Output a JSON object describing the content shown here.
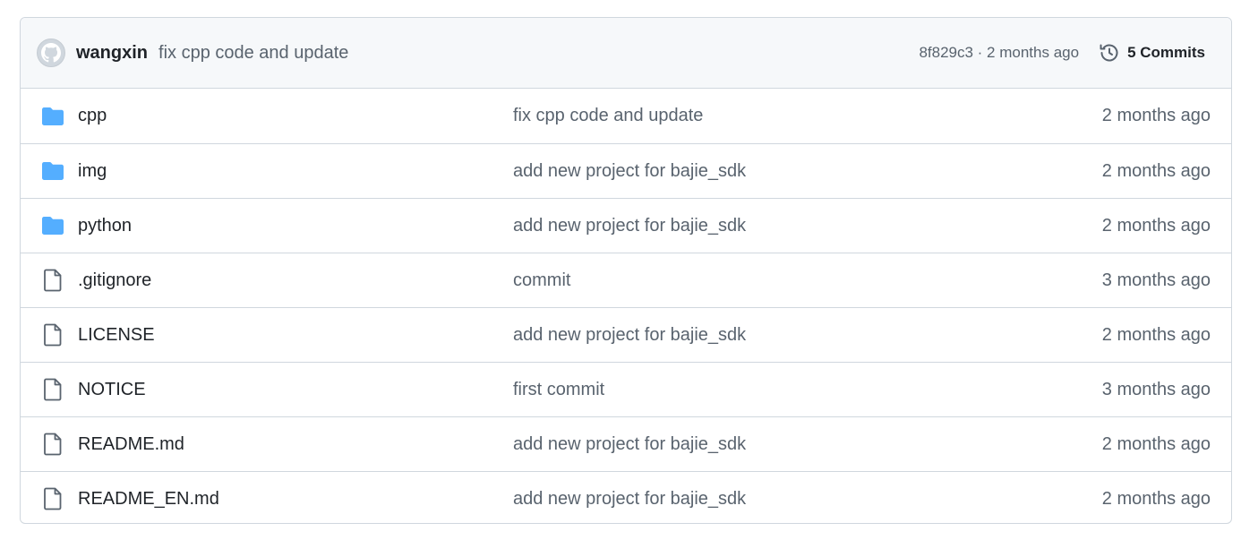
{
  "latest_commit": {
    "author": "wangxin",
    "message": "fix cpp code and update",
    "meta": "8f829c3 · 2 months ago",
    "commits_label": "5 Commits"
  },
  "files": [
    {
      "type": "folder",
      "icon": "folder-icon",
      "name": "cpp",
      "message": "fix cpp code and update",
      "age": "2 months ago"
    },
    {
      "type": "folder",
      "icon": "folder-icon",
      "name": "img",
      "message": "add new project for bajie_sdk",
      "age": "2 months ago"
    },
    {
      "type": "folder",
      "icon": "folder-icon",
      "name": "python",
      "message": "add new project for bajie_sdk",
      "age": "2 months ago"
    },
    {
      "type": "file",
      "icon": "file-icon",
      "name": ".gitignore",
      "message": "commit",
      "age": "3 months ago"
    },
    {
      "type": "file",
      "icon": "file-icon",
      "name": "LICENSE",
      "message": "add new project for bajie_sdk",
      "age": "2 months ago"
    },
    {
      "type": "file",
      "icon": "file-icon",
      "name": "NOTICE",
      "message": "first commit",
      "age": "3 months ago"
    },
    {
      "type": "file",
      "icon": "file-icon",
      "name": "README.md",
      "message": "add new project for bajie_sdk",
      "age": "2 months ago"
    },
    {
      "type": "file",
      "icon": "file-icon",
      "name": "README_EN.md",
      "message": "add new project for bajie_sdk",
      "age": "2 months ago"
    }
  ],
  "colors": {
    "folder": "#54aeff",
    "file_icon": "#59636e",
    "border": "#d0d7de",
    "header_bg": "#f6f8fa"
  }
}
